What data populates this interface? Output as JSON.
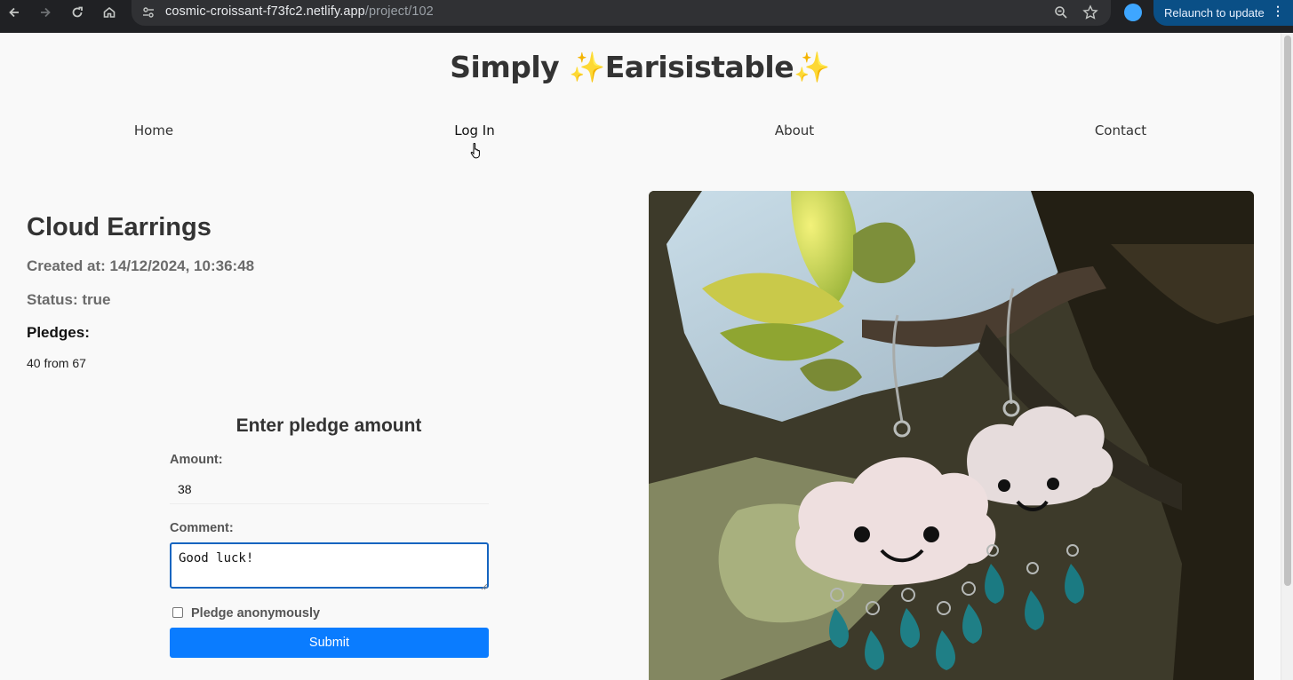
{
  "browser": {
    "url_host": "cosmic-croissant-f73fc2.netlify.app",
    "url_path": "/project/102",
    "relaunch_label": "Relaunch to update"
  },
  "site": {
    "title_part1": "Simply ",
    "sparkle": "✨",
    "title_part2": "Earisistable"
  },
  "nav": {
    "items": [
      {
        "label": "Home"
      },
      {
        "label": "Log In"
      },
      {
        "label": "About"
      },
      {
        "label": "Contact"
      }
    ]
  },
  "project": {
    "title": "Cloud Earrings",
    "created_at": "Created at: 14/12/2024, 10:36:48",
    "status": "Status: true",
    "pledges_label": "Pledges:",
    "pledges_value": "40 from 67"
  },
  "pledge_form": {
    "title": "Enter pledge amount",
    "amount_label": "Amount:",
    "amount_value": "38",
    "comment_label": "Comment:",
    "comment_value": "Good luck!",
    "anonymous_label": "Pledge anonymously",
    "anonymous_checked": false,
    "submit_label": "Submit"
  },
  "colors": {
    "accent": "#0a7cff",
    "focus_border": "#1565c0"
  }
}
